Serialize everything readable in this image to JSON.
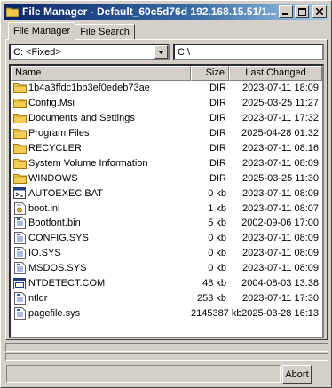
{
  "window": {
    "title": "File Manager - Default_60c5d76d 192.168.15.51/1...",
    "controls": [
      "minimize",
      "maximize",
      "close"
    ]
  },
  "tabs": [
    {
      "label": "File Manager",
      "active": true
    },
    {
      "label": "File Search",
      "active": false
    }
  ],
  "drive_select": {
    "value": "C: <Fixed>"
  },
  "path_input": {
    "value": "C:\\"
  },
  "columns": {
    "name": "Name",
    "size": "Size",
    "changed": "Last Changed"
  },
  "files": [
    {
      "icon": "folder-icon",
      "name": "1b4a3ffdc1bb3ef0edeb73ae",
      "size": "DIR",
      "changed": "2023-07-11 18:09"
    },
    {
      "icon": "folder-icon",
      "name": "Config.Msi",
      "size": "DIR",
      "changed": "2025-03-25 11:27"
    },
    {
      "icon": "folder-icon",
      "name": "Documents and Settings",
      "size": "DIR",
      "changed": "2023-07-11 17:32"
    },
    {
      "icon": "folder-icon",
      "name": "Program Files",
      "size": "DIR",
      "changed": "2025-04-28 01:32"
    },
    {
      "icon": "folder-icon",
      "name": "RECYCLER",
      "size": "DIR",
      "changed": "2023-07-11 08:16"
    },
    {
      "icon": "folder-icon",
      "name": "System Volume Information",
      "size": "DIR",
      "changed": "2023-07-11 08:09"
    },
    {
      "icon": "folder-icon",
      "name": "WINDOWS",
      "size": "DIR",
      "changed": "2025-03-25 11:30"
    },
    {
      "icon": "batch-file-icon",
      "name": "AUTOEXEC.BAT",
      "size": "0 kb",
      "changed": "2023-07-11 08:09"
    },
    {
      "icon": "settings-file-icon",
      "name": "boot.ini",
      "size": "1 kb",
      "changed": "2023-07-11 08:07"
    },
    {
      "icon": "system-file-icon",
      "name": "Bootfont.bin",
      "size": "5 kb",
      "changed": "2002-09-06 17:00"
    },
    {
      "icon": "system-file-icon",
      "name": "CONFIG.SYS",
      "size": "0 kb",
      "changed": "2023-07-11 08:09"
    },
    {
      "icon": "system-file-icon",
      "name": "IO.SYS",
      "size": "0 kb",
      "changed": "2023-07-11 08:09"
    },
    {
      "icon": "system-file-icon",
      "name": "MSDOS.SYS",
      "size": "0 kb",
      "changed": "2023-07-11 08:09"
    },
    {
      "icon": "application-file-icon",
      "name": "NTDETECT.COM",
      "size": "48 kb",
      "changed": "2004-08-03 13:38"
    },
    {
      "icon": "system-file-icon",
      "name": "ntldr",
      "size": "253 kb",
      "changed": "2023-07-11 17:30"
    },
    {
      "icon": "system-file-icon",
      "name": "pagefile.sys",
      "size": "2145387 kb",
      "changed": "2025-03-28 16:13"
    }
  ],
  "status": {
    "text": ""
  },
  "abort_button": {
    "label": "Abort"
  }
}
